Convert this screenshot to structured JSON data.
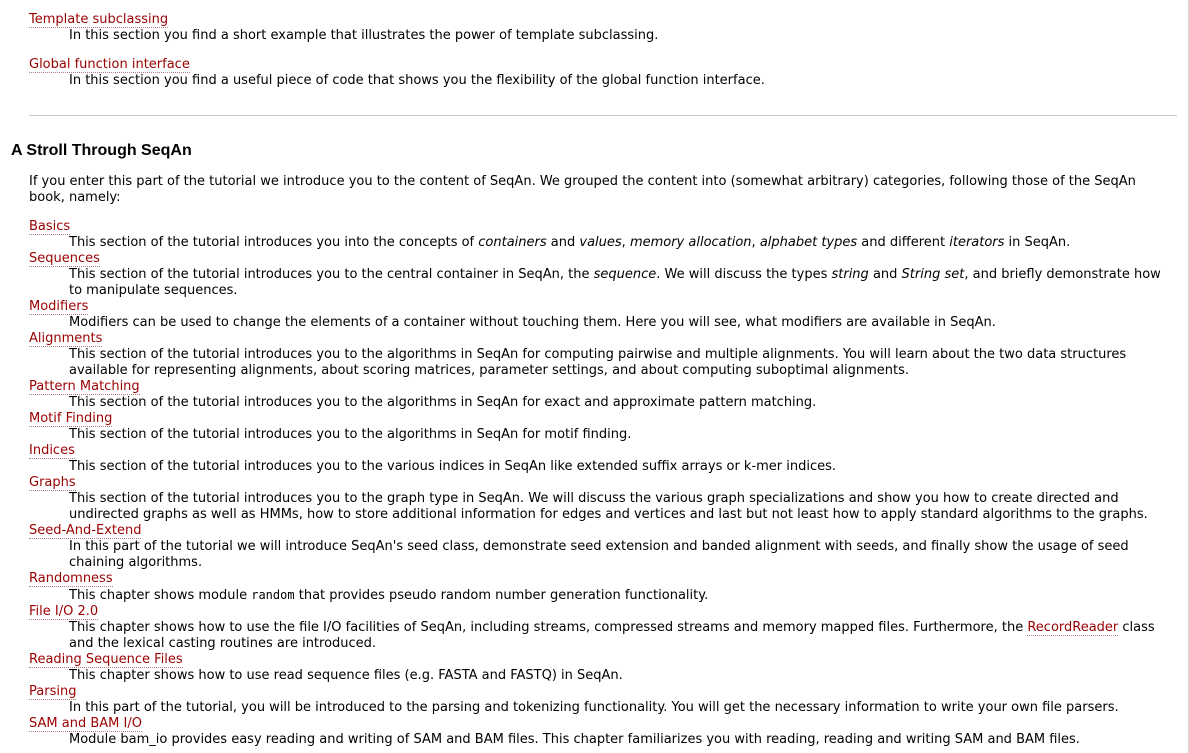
{
  "top": [
    {
      "title": "Template subclassing",
      "desc": "In this section you find a short example that illustrates the power of template subclassing."
    },
    {
      "title": "Global function interface",
      "desc": "In this section you find a useful piece of code that shows you the flexibility of the global function interface."
    }
  ],
  "section": {
    "title": "A Stroll Through SeqAn",
    "intro": "If you enter this part of the tutorial we introduce you to the content of SeqAn. We grouped the content into (somewhat arbitrary) categories, following those of the SeqAn book, namely:"
  },
  "items": [
    {
      "title": "Basics",
      "desc": {
        "p1": "This section of the tutorial introduces you into the concepts of ",
        "e1": "containers",
        "p2": " and ",
        "e2": "values",
        "p3": ", ",
        "e3": "memory allocation",
        "p4": ", ",
        "e4": "alphabet types",
        "p5": " and different ",
        "e5": "iterators",
        "p6": " in SeqAn."
      }
    },
    {
      "title": "Sequences",
      "desc": {
        "p1": "This section of the tutorial introduces you to the central container in SeqAn, the ",
        "e1": "sequence",
        "p2": ". We will discuss the types ",
        "e2": "string",
        "p3": " and ",
        "e3": "String set",
        "p4": ", and briefly demonstrate how to manipulate sequences."
      }
    },
    {
      "title": "Modifiers",
      "desc": "Modifiers can be used to change the elements of a container without touching them. Here you will see, what modifiers are available in SeqAn."
    },
    {
      "title": "Alignments",
      "desc": "This section of the tutorial introduces you to the algorithms in SeqAn for computing pairwise and multiple alignments. You will learn about the two data structures available for representing alignments, about scoring matrices, parameter settings, and about computing suboptimal alignments."
    },
    {
      "title": "Pattern Matching",
      "desc": "This section of the tutorial introduces you to the algorithms in SeqAn for exact and approximate pattern matching."
    },
    {
      "title": "Motif Finding",
      "desc": "This section of the tutorial introduces you to the algorithms in SeqAn for motif finding."
    },
    {
      "title": "Indices",
      "desc": "This section of the tutorial introduces you to the various indices in SeqAn like extended suffix arrays or k-mer indices."
    },
    {
      "title": "Graphs",
      "desc": "This section of the tutorial introduces you to the graph type in SeqAn. We will discuss the various graph specializations and show you how to create directed and undirected graphs as well as HMMs, how to store additional information for edges and vertices and last but not least how to apply standard algorithms to the graphs."
    },
    {
      "title": "Seed-And-Extend",
      "desc": "In this part of the tutorial we will introduce SeqAn's seed class, demonstrate seed extension and banded alignment with seeds, and finally show the usage of seed chaining algorithms."
    },
    {
      "title": "Randomness",
      "desc": {
        "p1": "This chapter shows module ",
        "code": "random",
        "p2": " that provides pseudo random number generation functionality."
      }
    },
    {
      "title": "File I/O 2.0",
      "desc": {
        "p1": "This chapter shows how to use the file I/O facilities of SeqAn, including streams, compressed streams and memory mapped files. Furthermore, the ",
        "link": "RecordReader",
        "p2": " class and the lexical casting routines are introduced."
      }
    },
    {
      "title": "Reading Sequence Files",
      "desc": "This chapter shows how to use read sequence files (e.g. FASTA and FASTQ) in SeqAn."
    },
    {
      "title": "Parsing",
      "desc": "In this part of the tutorial, you will be introduced to the parsing and tokenizing functionality. You will get the necessary information to write your own file parsers."
    },
    {
      "title": "SAM and BAM I/O",
      "desc": "Module bam_io provides easy reading and writing of SAM and BAM files. This chapter familiarizes you with reading, reading and writing SAM and BAM files."
    }
  ]
}
